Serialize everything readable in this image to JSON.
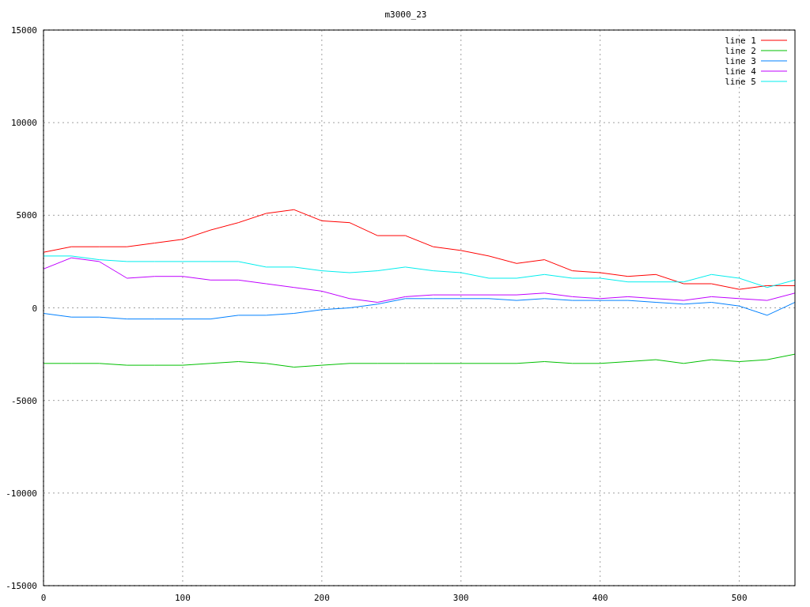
{
  "chart_data": {
    "type": "line",
    "title": "m3000_23",
    "x": [
      0,
      20,
      40,
      60,
      80,
      100,
      120,
      140,
      160,
      180,
      200,
      220,
      240,
      260,
      280,
      300,
      320,
      340,
      360,
      380,
      400,
      420,
      440,
      460,
      480,
      500,
      520,
      540
    ],
    "series": [
      {
        "name": "line 1",
        "color": "#ff0000",
        "values": [
          3000,
          3300,
          3300,
          3300,
          3500,
          3700,
          4200,
          4600,
          5100,
          5300,
          4700,
          4600,
          3900,
          3900,
          3300,
          3100,
          2800,
          2400,
          2600,
          2000,
          1900,
          1700,
          1800,
          1300,
          1300,
          1000,
          1200,
          1200
        ]
      },
      {
        "name": "line 2",
        "color": "#00c000",
        "values": [
          -3000,
          -3000,
          -3000,
          -3100,
          -3100,
          -3100,
          -3000,
          -2900,
          -3000,
          -3200,
          -3100,
          -3000,
          -3000,
          -3000,
          -3000,
          -3000,
          -3000,
          -3000,
          -2900,
          -3000,
          -3000,
          -2900,
          -2800,
          -3000,
          -2800,
          -2900,
          -2800,
          -2500
        ]
      },
      {
        "name": "line 3",
        "color": "#0080ff",
        "values": [
          -300,
          -500,
          -500,
          -600,
          -600,
          -600,
          -600,
          -400,
          -400,
          -300,
          -100,
          0,
          200,
          500,
          500,
          500,
          500,
          400,
          500,
          400,
          400,
          400,
          300,
          200,
          300,
          100,
          -400,
          300
        ]
      },
      {
        "name": "line 4",
        "color": "#c000ff",
        "values": [
          2100,
          2700,
          2500,
          1600,
          1700,
          1700,
          1500,
          1500,
          1300,
          1100,
          900,
          500,
          300,
          600,
          700,
          700,
          700,
          700,
          800,
          600,
          500,
          600,
          500,
          400,
          600,
          500,
          400,
          800
        ]
      },
      {
        "name": "line 5",
        "color": "#00eeee",
        "values": [
          2800,
          2800,
          2600,
          2500,
          2500,
          2500,
          2500,
          2500,
          2200,
          2200,
          2000,
          1900,
          2000,
          2200,
          2000,
          1900,
          1600,
          1600,
          1800,
          1600,
          1600,
          1400,
          1400,
          1400,
          1800,
          1600,
          1100,
          1500
        ]
      }
    ],
    "grid": true,
    "legend": true,
    "xlim": [
      0,
      540
    ],
    "ylim": [
      -15000,
      15000
    ],
    "xticks": [
      0,
      100,
      200,
      300,
      400,
      500
    ],
    "yticks": [
      -15000,
      -10000,
      -5000,
      0,
      5000,
      10000,
      15000
    ]
  }
}
